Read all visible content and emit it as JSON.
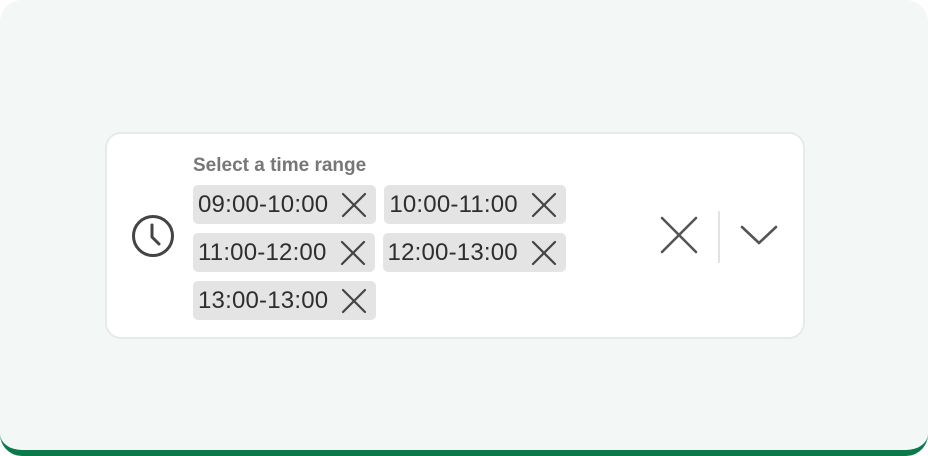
{
  "field": {
    "label": "Select a time range",
    "icon": "clock-icon",
    "selected": [
      {
        "label": "09:00-10:00",
        "remove_icon": "close-icon"
      },
      {
        "label": "10:00-11:00",
        "remove_icon": "close-icon"
      },
      {
        "label": "11:00-12:00",
        "remove_icon": "close-icon"
      },
      {
        "label": "12:00-13:00",
        "remove_icon": "close-icon"
      },
      {
        "label": "13:00-13:00",
        "remove_icon": "close-icon"
      }
    ],
    "clear_icon": "close-icon",
    "dropdown_icon": "chevron-down-icon"
  },
  "colors": {
    "background": "#f3f7f5",
    "accent_bar": "#0b7a4b",
    "chip_bg": "#e4e4e4",
    "label_text": "#777777",
    "chip_text": "#2e2e2e",
    "icon": "#555555"
  }
}
